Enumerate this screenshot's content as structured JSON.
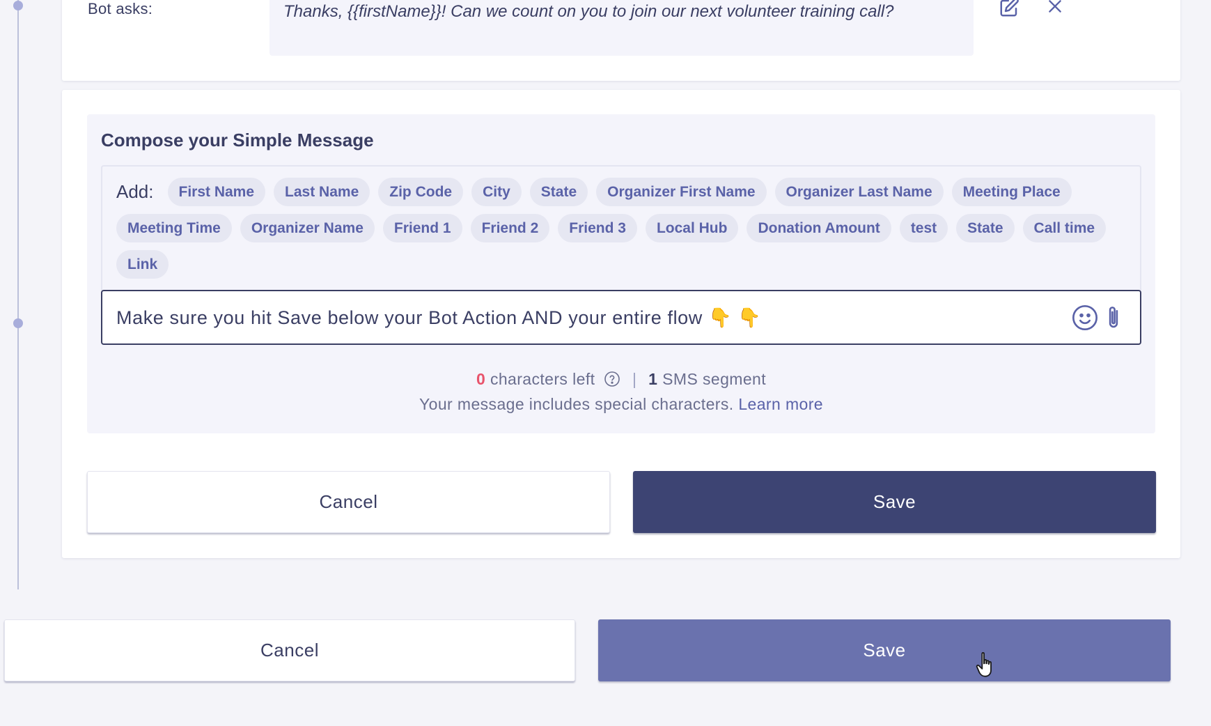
{
  "bot_question": {
    "label": "Bot asks:",
    "text": "Thanks, {{firstName}}! Can we count on you to join our next volunteer training call?"
  },
  "compose": {
    "title": "Compose your Simple Message",
    "add_label": "Add:",
    "tags": [
      "First Name",
      "Last Name",
      "Zip Code",
      "City",
      "State",
      "Organizer First Name",
      "Organizer Last Name",
      "Meeting Place",
      "Meeting Time",
      "Organizer Name",
      "Friend 1",
      "Friend 2",
      "Friend 3",
      "Local Hub",
      "Donation Amount",
      "test",
      "State",
      "Call time",
      "Link"
    ],
    "message_value": "Make sure you hit Save below your Bot Action AND your entire flow 👇 👇",
    "chars_left_count": "0",
    "chars_left_text": "characters left",
    "sms_segment_count": "1",
    "sms_segment_text": "SMS segment",
    "special_chars_text": "Your message includes special characters.",
    "learn_more": "Learn more"
  },
  "action_buttons": {
    "cancel": "Cancel",
    "save": "Save"
  },
  "flow_buttons": {
    "cancel": "Cancel",
    "save": "Save"
  },
  "colors": {
    "primary_dark": "#3d4473",
    "primary_light": "#6a72ae",
    "tag_text": "#5a62a8",
    "warning": "#e8536b"
  }
}
